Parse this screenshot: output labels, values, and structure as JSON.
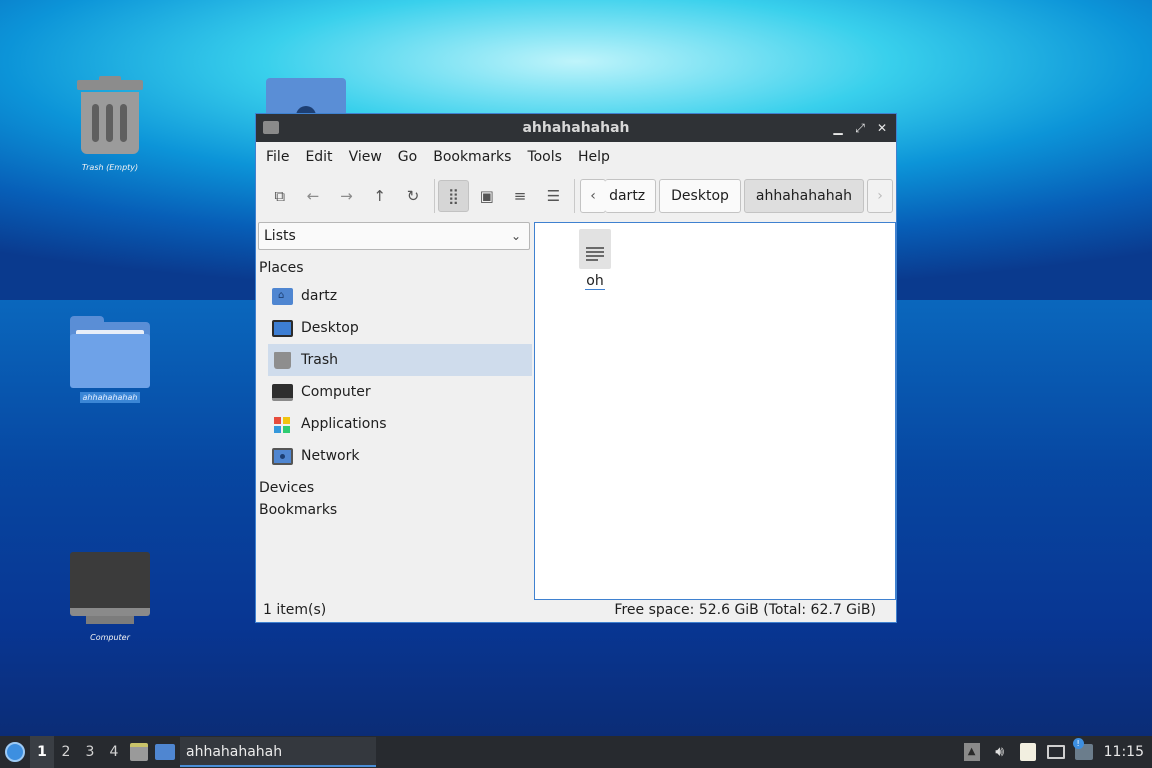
{
  "desktop": {
    "icons": [
      {
        "label": "Trash (Empty)"
      },
      {
        "label": "ahhahahahah"
      },
      {
        "label": "Computer"
      }
    ]
  },
  "window": {
    "title": "ahhahahahah",
    "controls": {
      "minimize": "▁",
      "maximize": "⤢",
      "close": "✕"
    },
    "menu": [
      "File",
      "Edit",
      "View",
      "Go",
      "Bookmarks",
      "Tools",
      "Help"
    ],
    "toolbar": {
      "icons": [
        "new-window-icon",
        "back-icon",
        "forward-icon",
        "up-icon",
        "reload-icon",
        "icon-view-icon",
        "thumbnail-view-icon",
        "compact-list-icon",
        "detailed-list-icon"
      ],
      "glyphs": {
        "new_window": "⧉",
        "back": "←",
        "forward": "→",
        "up": "↑",
        "reload": "↻",
        "icon_view": "⣿",
        "thumbnail": "▣",
        "compact": "≡",
        "detailed": "☰"
      }
    },
    "breadcrumb": {
      "prev": "‹",
      "next": "›",
      "items": [
        "dartz",
        "Desktop",
        "ahhahahahah"
      ]
    },
    "sidebar": {
      "pane_selector": "Lists",
      "places_heading": "Places",
      "places": [
        {
          "label": "dartz",
          "icon": "home-folder-icon"
        },
        {
          "label": "Desktop",
          "icon": "desktop-icon"
        },
        {
          "label": "Trash",
          "icon": "trash-icon",
          "selected": true
        },
        {
          "label": "Computer",
          "icon": "computer-icon"
        },
        {
          "label": "Applications",
          "icon": "applications-icon"
        },
        {
          "label": "Network",
          "icon": "network-icon"
        }
      ],
      "devices_heading": "Devices",
      "bookmarks_heading": "Bookmarks"
    },
    "files": [
      {
        "name": "oh",
        "icon": "text-document-icon"
      }
    ],
    "status": {
      "count": "1 item(s)",
      "free_space": "Free space: 52.6 GiB (Total: 62.7 GiB)"
    }
  },
  "panel": {
    "workspaces": [
      "1",
      "2",
      "3",
      "4"
    ],
    "active_workspace": "1",
    "task_title": "ahhahahahah",
    "clock": "11:15"
  },
  "colors": {
    "accent": "#3f81d0",
    "selection": "#cfdcec",
    "panel": "#272a2f",
    "titlebar": "#2f3236"
  }
}
